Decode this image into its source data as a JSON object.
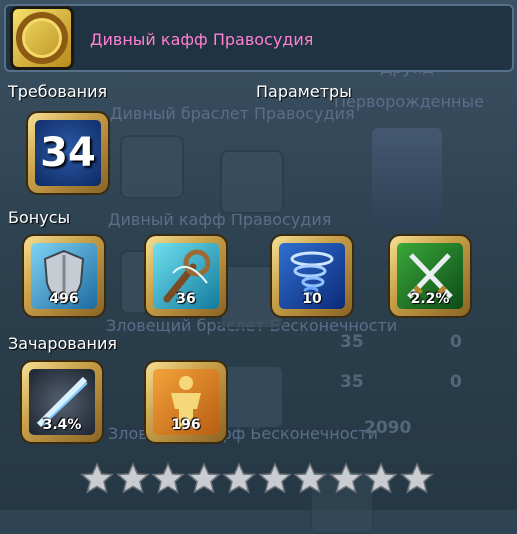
{
  "item": {
    "name": "Дивный кафф Правосудия",
    "icon": "golden-chain-bracelet-icon"
  },
  "requirements": {
    "label": "Требования",
    "level": "34"
  },
  "parameters": {
    "label": "Параметры"
  },
  "bonuses": {
    "label": "Бонусы",
    "items": [
      {
        "icon": "shield-icon",
        "value": "496"
      },
      {
        "icon": "staff-icon",
        "value": "36"
      },
      {
        "icon": "tornado-icon",
        "value": "10"
      },
      {
        "icon": "crossed-swords-icon",
        "value": "2.2%"
      }
    ]
  },
  "enchantments": {
    "label": "Зачарования",
    "items": [
      {
        "icon": "slash-icon",
        "value": "3.4%"
      },
      {
        "icon": "golden-figure-icon",
        "value": "196"
      }
    ]
  },
  "stars": {
    "filled": 0,
    "total": 10
  },
  "background": {
    "class_name": "Друид",
    "race_name": "Перворожденные",
    "item_1": "Дивный браслет Правосудия",
    "item_2": "Дивный кафф Правосудия",
    "item_3": "Зловещий браслет Бесконечности",
    "item_4": "Зловещий кафф Бесконечности",
    "numbers": [
      "35",
      "0",
      "35",
      "0",
      "2090"
    ]
  },
  "colors": {
    "title": "#ff7fd0",
    "label": "#ffffff",
    "frame": "#c9a14a"
  }
}
